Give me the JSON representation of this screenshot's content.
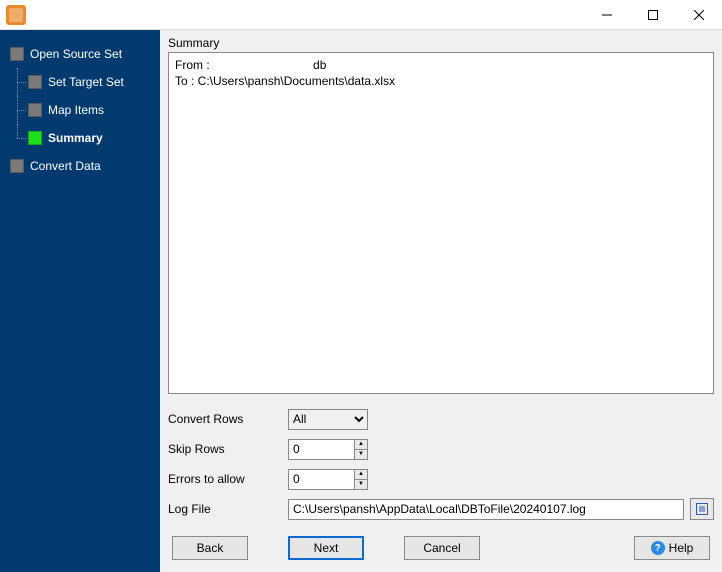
{
  "titlebar": {
    "minimize": "—",
    "maximize": "▢",
    "close": "✕"
  },
  "sidebar": {
    "items": [
      {
        "label": "Open Source Set",
        "level": 0,
        "active": false,
        "bold": false
      },
      {
        "label": "Set Target Set",
        "level": 1,
        "active": false,
        "bold": false
      },
      {
        "label": "Map Items",
        "level": 1,
        "active": false,
        "bold": false
      },
      {
        "label": "Summary",
        "level": 1,
        "active": true,
        "bold": true
      },
      {
        "label": "Convert Data",
        "level": 0,
        "active": false,
        "bold": false
      }
    ]
  },
  "panel": {
    "group_label": "Summary",
    "summary_text": "From :                               db\nTo : C:\\Users\\pansh\\Documents\\data.xlsx",
    "fields": {
      "convert_rows": {
        "label": "Convert Rows",
        "value": "All",
        "options": [
          "All"
        ]
      },
      "skip_rows": {
        "label": "Skip Rows",
        "value": "0"
      },
      "errors_allow": {
        "label": "Errors to allow",
        "value": "0"
      },
      "log_file": {
        "label": "Log File",
        "value": "C:\\Users\\pansh\\AppData\\Local\\DBToFile\\20240107.log"
      }
    }
  },
  "buttons": {
    "back": "Back",
    "next": "Next",
    "cancel": "Cancel",
    "help": "Help"
  }
}
